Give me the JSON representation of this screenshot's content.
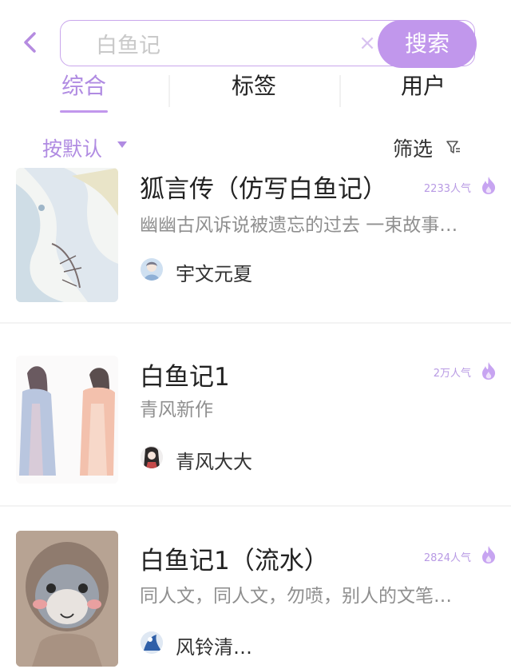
{
  "search": {
    "query": "白鱼记",
    "clear_icon": "clear-x-icon",
    "button_label": "搜索"
  },
  "tabs": [
    {
      "label": "综合",
      "active": true
    },
    {
      "label": "标签",
      "active": false
    },
    {
      "label": "用户",
      "active": false
    }
  ],
  "sort": {
    "label": "按默认"
  },
  "filter": {
    "label": "筛选"
  },
  "results": [
    {
      "title": "狐言传（仿写白鱼记）",
      "popularity": "2233人气",
      "description": "幽幽古风诉说被遗忘的过去 一束故事…",
      "author": "宇文元夏"
    },
    {
      "title": "白鱼记1",
      "popularity": "2万人气",
      "description": "青风新作",
      "author": "青风大大"
    },
    {
      "title": "白鱼记1（流水）",
      "popularity": "2824人气",
      "description": "同人文，同人文，勿喷，别人的文笔…",
      "author": "风铃清…"
    }
  ],
  "colors": {
    "accent": "#c197ec",
    "accent_text": "#b08be2",
    "popularity": "#b89ae4"
  }
}
